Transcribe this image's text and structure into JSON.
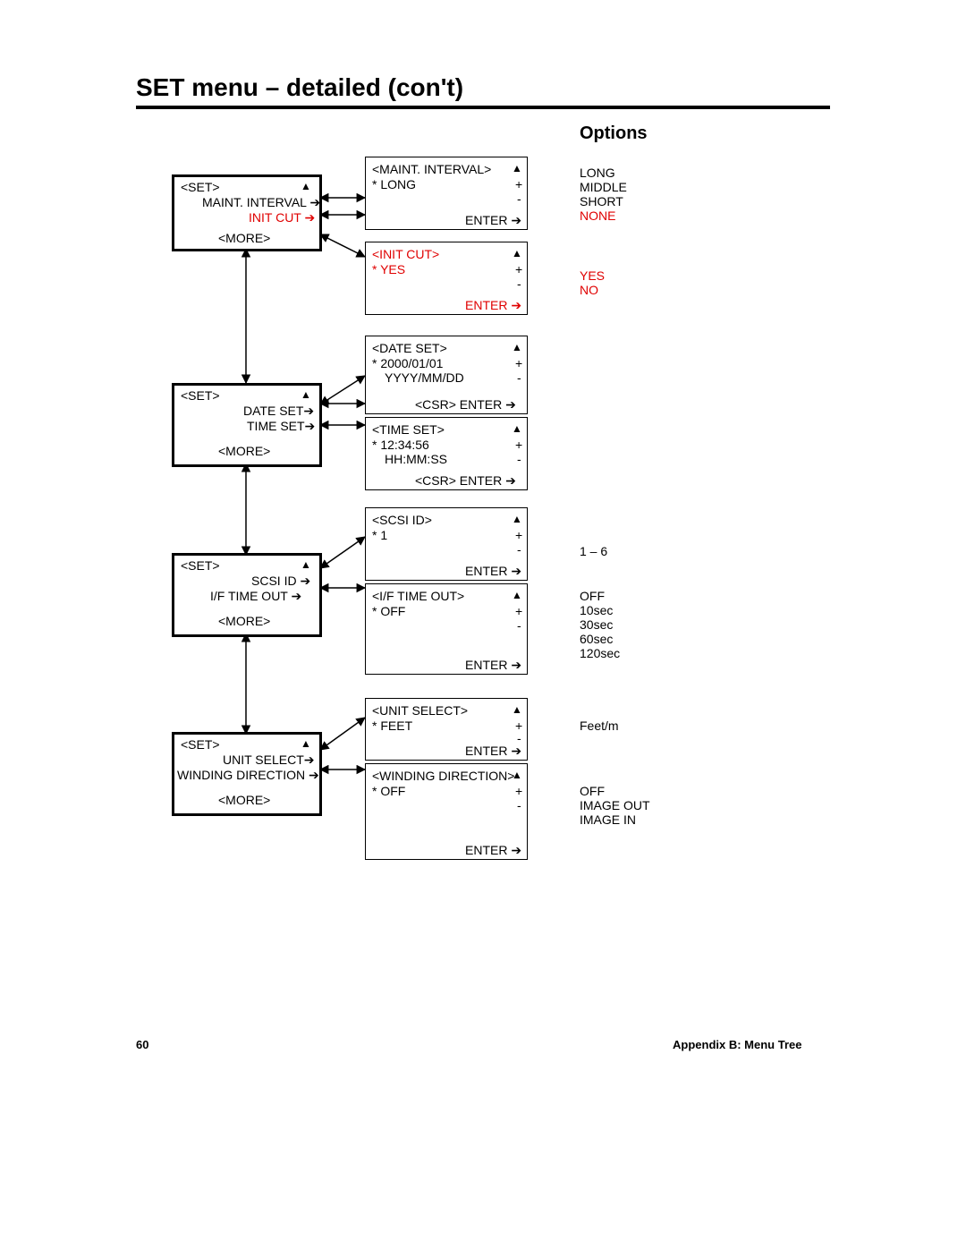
{
  "page": {
    "title": "SET menu – detailed (con't)",
    "section_heading": "Options",
    "footer_page": "60",
    "footer_right": "Appendix B:  Menu Tree"
  },
  "symbols": {
    "up": "▲",
    "plus": "+",
    "minus": "-",
    "arrow_r": "➔"
  },
  "setA": {
    "header": "<SET>",
    "line1": "MAINT. INTERVAL ➔",
    "line2": "INIT CUT ➔",
    "more": "<MORE>"
  },
  "maint": {
    "head": "<MAINT. INTERVAL>",
    "val": "*  LONG",
    "enter": "ENTER ➔"
  },
  "init": {
    "head": "<INIT CUT>",
    "val": "*  YES",
    "enter": "ENTER ➔"
  },
  "setB": {
    "header": "<SET>",
    "line1": "DATE SET➔",
    "line2": "TIME SET➔",
    "more": "<MORE>"
  },
  "date": {
    "head": "<DATE SET>",
    "val": "*  2000/01/01",
    "fmt": "YYYY/MM/DD",
    "enter": "<CSR>  ENTER ➔"
  },
  "time": {
    "head": "<TIME SET>",
    "val": "*  12:34:56",
    "fmt": "HH:MM:SS",
    "enter": "<CSR>  ENTER ➔"
  },
  "setC": {
    "header": "<SET>",
    "line1": "SCSI ID ➔",
    "line2": "I/F TIME OUT ➔",
    "more": "<MORE>"
  },
  "scsi": {
    "head": "<SCSI ID>",
    "val": "*  1",
    "enter": "ENTER ➔"
  },
  "ifto": {
    "head": "<I/F TIME OUT>",
    "val": "*  OFF",
    "enter": "ENTER ➔"
  },
  "setD": {
    "header": "<SET>",
    "line1": "UNIT SELECT➔",
    "line2": "WINDING DIRECTION ➔",
    "more": "<MORE>"
  },
  "unit": {
    "head": "<UNIT SELECT>",
    "val": "*  FEET",
    "enter": "ENTER ➔"
  },
  "wind": {
    "head": "<WINDING DIRECTION>",
    "val": "*  OFF",
    "enter": "ENTER ➔"
  },
  "opt": {
    "maint": [
      "LONG",
      "MIDDLE",
      "SHORT",
      "NONE"
    ],
    "init": [
      "YES",
      "NO"
    ],
    "scsi": "1 – 6",
    "ifto": [
      "OFF",
      "10sec",
      "30sec",
      "60sec",
      "120sec"
    ],
    "unit": "Feet/m",
    "wind": [
      "OFF",
      "IMAGE OUT",
      "IMAGE IN"
    ]
  }
}
